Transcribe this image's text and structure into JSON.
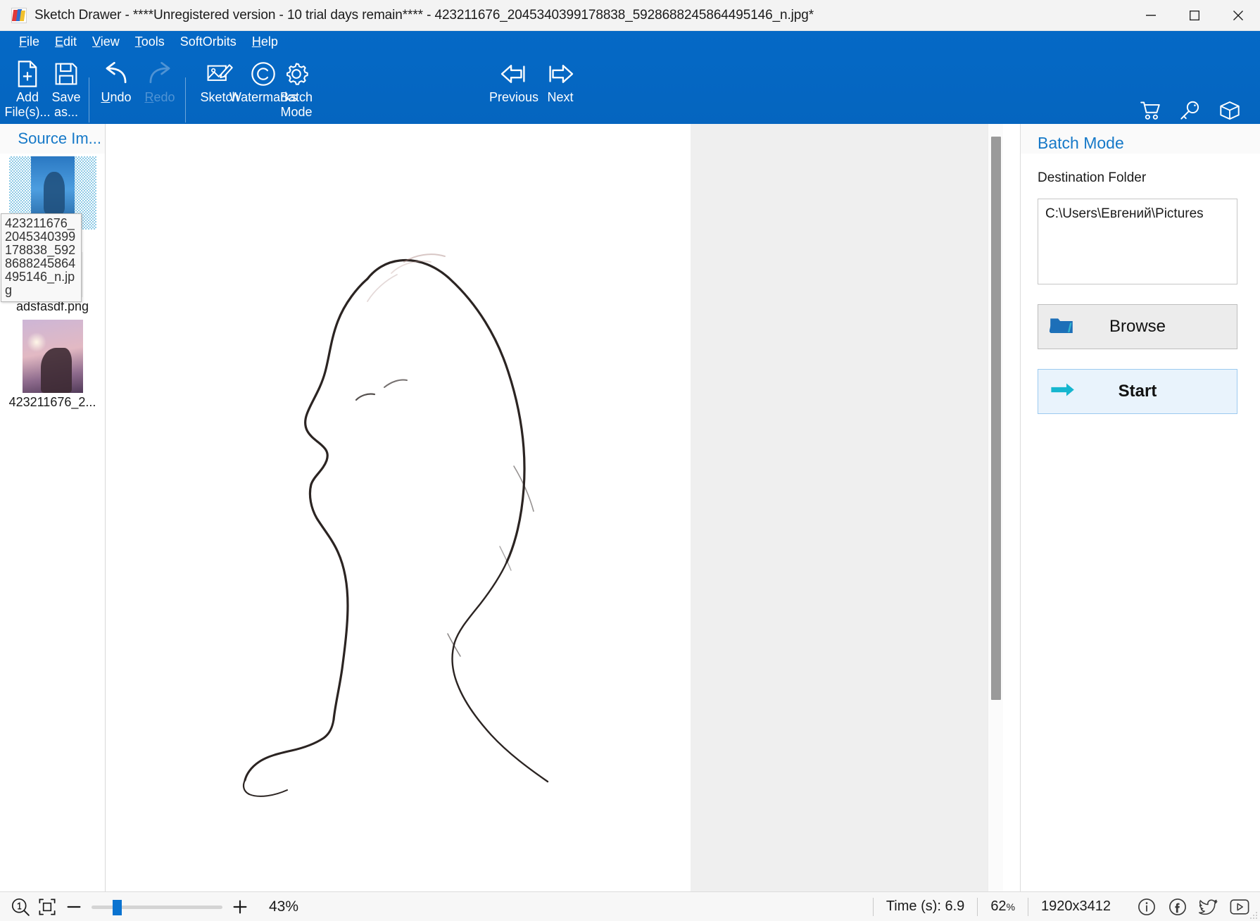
{
  "window": {
    "title": "Sketch Drawer - ****Unregistered version - 10 trial days remain**** - 423211676_2045340399178838_5928688245864495146_n.jpg*",
    "app_name": "Sketch Drawer",
    "minimize_label": "Minimize",
    "maximize_label": "Maximize",
    "close_label": "Close"
  },
  "menu": {
    "items": [
      {
        "pre": "",
        "key": "F",
        "post": "ile"
      },
      {
        "pre": "",
        "key": "E",
        "post": "dit"
      },
      {
        "pre": "",
        "key": "V",
        "post": "iew"
      },
      {
        "pre": "",
        "key": "T",
        "post": "ools"
      },
      {
        "pre": "SoftOrbits",
        "key": "",
        "post": ""
      },
      {
        "pre": "",
        "key": "H",
        "post": "elp"
      }
    ]
  },
  "toolbar": {
    "add_files": "Add\nFile(s)...",
    "save_as": "Save\nas...",
    "undo": "Undo",
    "redo": "Redo",
    "sketch": "Sketch",
    "watermarks": "Watermarks",
    "batch_mode": "Batch\nMode",
    "previous": "Previous",
    "next": "Next",
    "cart_icon": "shopping-cart-icon",
    "key_icon": "key-icon",
    "box_icon": "box-icon"
  },
  "sidebar": {
    "title": "Source Im...",
    "tooltip": "423211676_2045340399178838_5928688245864495146_n.jpg",
    "items": [
      {
        "label": "423211676_204 5340399178838 _592868824586 4495146_n.jpg",
        "selected": true
      },
      {
        "label": "adsfasdf.png",
        "selected": false
      },
      {
        "label": "423211676_2...",
        "selected": false
      }
    ]
  },
  "right_panel": {
    "title": "Batch Mode",
    "destination_label": "Destination Folder",
    "destination_value": "C:\\Users\\Евгений\\Pictures",
    "browse_label": "Browse",
    "browse_icon": "folder-icon",
    "start_label": "Start",
    "start_icon": "arrow-right-icon"
  },
  "statusbar": {
    "zoom_actual_icon": "zoom-actual-size-icon",
    "fit_icon": "fit-to-window-icon",
    "zoom_out_label": "—",
    "zoom_in_label": "+",
    "zoom_percent": "43%",
    "time_label": "Time (s): 6.9",
    "progress_percent": "62",
    "progress_percent_symbol": "%",
    "dimensions": "1920x3412",
    "info_icon": "info-icon",
    "facebook_icon": "facebook-icon",
    "twitter_icon": "twitter-icon",
    "youtube_icon": "youtube-icon"
  },
  "colors": {
    "ribbon": "#0567c3",
    "accent_text": "#1679c8",
    "slider_thumb": "#0a73d0",
    "primary_button_bg": "#e9f3fc"
  }
}
